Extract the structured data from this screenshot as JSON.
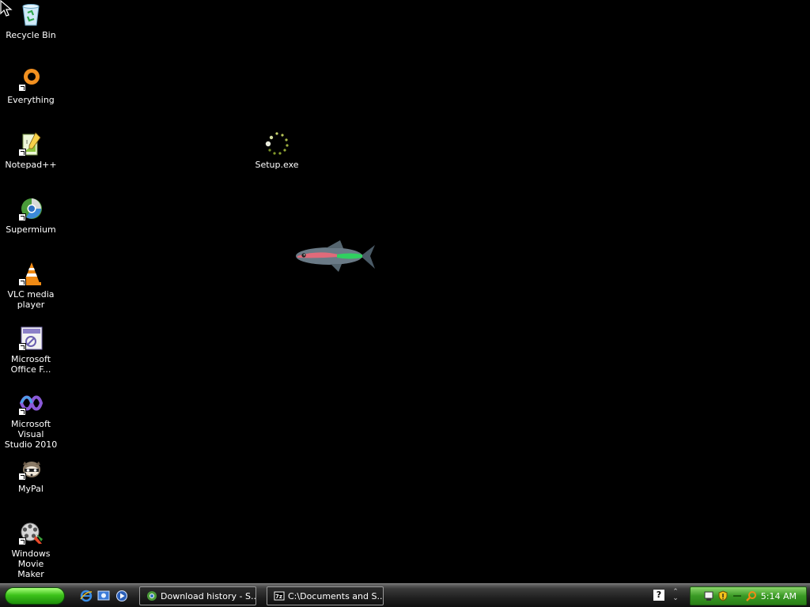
{
  "desktop": {
    "icons": [
      {
        "label": "Recycle Bin",
        "icon": "recycle-bin-icon"
      },
      {
        "label": "Everything",
        "icon": "everything-icon"
      },
      {
        "label": "Notepad++",
        "icon": "notepadpp-icon"
      },
      {
        "label": "Supermium",
        "icon": "supermium-icon"
      },
      {
        "label": "VLC media\nplayer",
        "icon": "vlc-icon"
      },
      {
        "label": "Microsoft\nOffice F...",
        "icon": "office-icon"
      },
      {
        "label": "Microsoft Visual\nStudio 2010",
        "icon": "visual-studio-icon"
      },
      {
        "label": "MyPal",
        "icon": "mypal-icon"
      },
      {
        "label": "Windows Movie\nMaker",
        "icon": "movie-maker-icon"
      }
    ],
    "setup": {
      "label": "Setup.exe",
      "icon": "loading-spinner-icon"
    }
  },
  "taskbar": {
    "start_label": "",
    "tasks": [
      {
        "label": "Download history - S..."
      },
      {
        "label": "C:\\Documents and S..."
      }
    ],
    "clock": "5:14 AM"
  },
  "colors": {
    "desktop_bg": "#000000",
    "start_green": "#3cc21a",
    "tray_green": "#3a9a25"
  }
}
